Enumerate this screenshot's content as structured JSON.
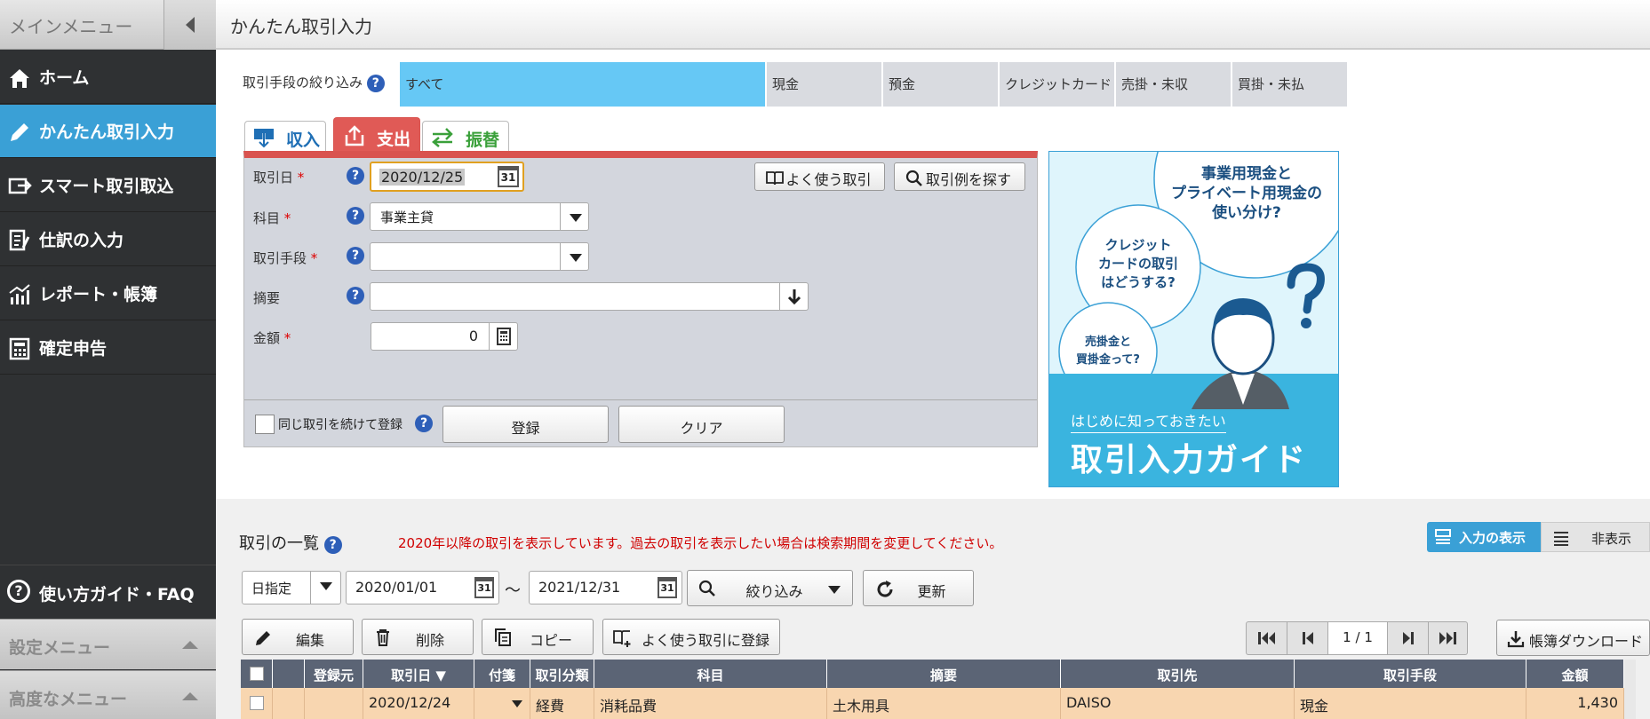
{
  "sidebar": {
    "header": "メインメニュー",
    "items": [
      {
        "label": "ホーム",
        "icon": "home-icon"
      },
      {
        "label": "かんたん取引入力",
        "icon": "pencil-icon",
        "active": true
      },
      {
        "label": "スマート取引取込",
        "icon": "import-icon"
      },
      {
        "label": "仕訳の入力",
        "icon": "journal-icon"
      },
      {
        "label": "レポート・帳簿",
        "icon": "chart-icon"
      },
      {
        "label": "確定申告",
        "icon": "calculator-icon"
      }
    ],
    "faq": "使い方ガイド・FAQ",
    "settings": "設定メニュー",
    "advanced": "高度なメニュー"
  },
  "page": {
    "title": "かんたん取引入力"
  },
  "filter": {
    "label": "取引手段の絞り込み",
    "tabs": [
      "すべて",
      "現金",
      "預金",
      "クレジットカード",
      "売掛・未収",
      "買掛・未払"
    ]
  },
  "entry_tabs": {
    "income": "収入",
    "expense": "支出",
    "transfer": "振替"
  },
  "form": {
    "date_label": "取引日",
    "date_value": "2020/12/25",
    "calendar_day": "31",
    "account_label": "科目",
    "account_value": "事業主貸",
    "method_label": "取引手段",
    "method_value": "",
    "memo_label": "摘要",
    "memo_value": "",
    "amount_label": "金額",
    "amount_value": "0",
    "required": "*",
    "help": "?",
    "favorite_btn": "よく使う取引",
    "search_btn": "取引例を探す",
    "continue_label": "同じ取引を続けて登録",
    "register_btn": "登録",
    "clear_btn": "クリア"
  },
  "banner": {
    "bubble1": [
      "事業用現金と",
      "プライベート用現金の",
      "使い分け?"
    ],
    "bubble2": [
      "クレジット",
      "カードの取引",
      "はどうする?"
    ],
    "bubble3": [
      "売掛金と",
      "買掛金って?"
    ],
    "question": "?",
    "sub": "はじめに知っておきたい",
    "main": "取引入力ガイド"
  },
  "list": {
    "title": "取引の一覧",
    "notice": "2020年以降の取引を表示しています。過去の取引を表示したい場合は検索期間を変更してください。",
    "view_on": "入力の表示",
    "view_off": "非表示",
    "date_mode": "日指定",
    "from": "2021/12/31",
    "from_start": "2020/01/01",
    "tilde": "〜",
    "calendar_day": "31",
    "filter_btn": "絞り込み",
    "refresh_btn": "更新",
    "edit_btn": "編集",
    "delete_btn": "削除",
    "copy_btn": "コピー",
    "fav_btn": "よく使う取引に登録",
    "page_current": "1",
    "page_sep": "/",
    "page_total": "1",
    "download_btn": "帳簿ダウンロード",
    "columns": [
      "登録元",
      "取引日 ▼",
      "付箋",
      "取引分類",
      "科目",
      "摘要",
      "取引先",
      "取引手段",
      "金額"
    ],
    "rows": [
      {
        "source": "",
        "date": "2020/12/24",
        "tag": "",
        "type": "経費",
        "account": "消耗品費",
        "memo": "土木用具",
        "partner": "DAISO",
        "method": "現金",
        "amount": "1,430"
      }
    ]
  },
  "colors": {
    "accent": "#3aa0d6",
    "expense_red": "#d9534f",
    "income_blue": "#1f6fb5",
    "transfer_green": "#3aa03a",
    "notice_red": "#d00000"
  }
}
